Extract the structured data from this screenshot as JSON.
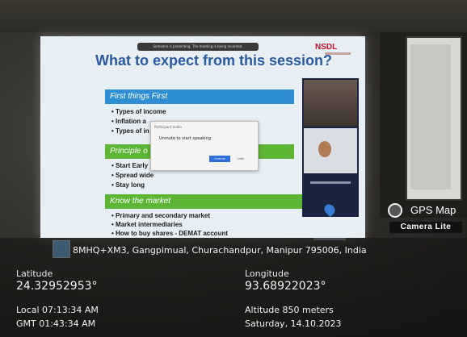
{
  "slide": {
    "logo": "NSDL",
    "title": "What to expect from this session?",
    "notice": "Someone is presenting. The meeting is being recorded.",
    "sections": [
      {
        "heading": "First things First",
        "bullets": [
          "Types of income",
          "Inflation a",
          "Types of in"
        ]
      },
      {
        "heading": "Principle o",
        "bullets": [
          "Start Early",
          "Spread wide",
          "Stay long"
        ]
      },
      {
        "heading": "Know the market",
        "bullets": [
          "Primary and secondary market",
          "Market intermediaries",
          "How to buy shares - DEMAT account"
        ]
      }
    ],
    "dialog": {
      "caption": "Participant audio",
      "message": "Unmute to start speaking",
      "primary": "Unmute",
      "secondary": "Later"
    }
  },
  "overlay": {
    "brand": "GPS Map",
    "brand_sub": "Camera Lite",
    "address": "8MHQ+XM3, Gangpimual, Churachandpur, Manipur 795006, India",
    "latitude_label": "Latitude",
    "latitude": "24.32952953°",
    "longitude_label": "Longitude",
    "longitude": "93.68922023°",
    "local_time": "Local 07:13:34 AM",
    "gmt_time": "GMT 01:43:34 AM",
    "altitude": "Altitude 850 meters",
    "date": "Saturday, 14.10.2023"
  }
}
